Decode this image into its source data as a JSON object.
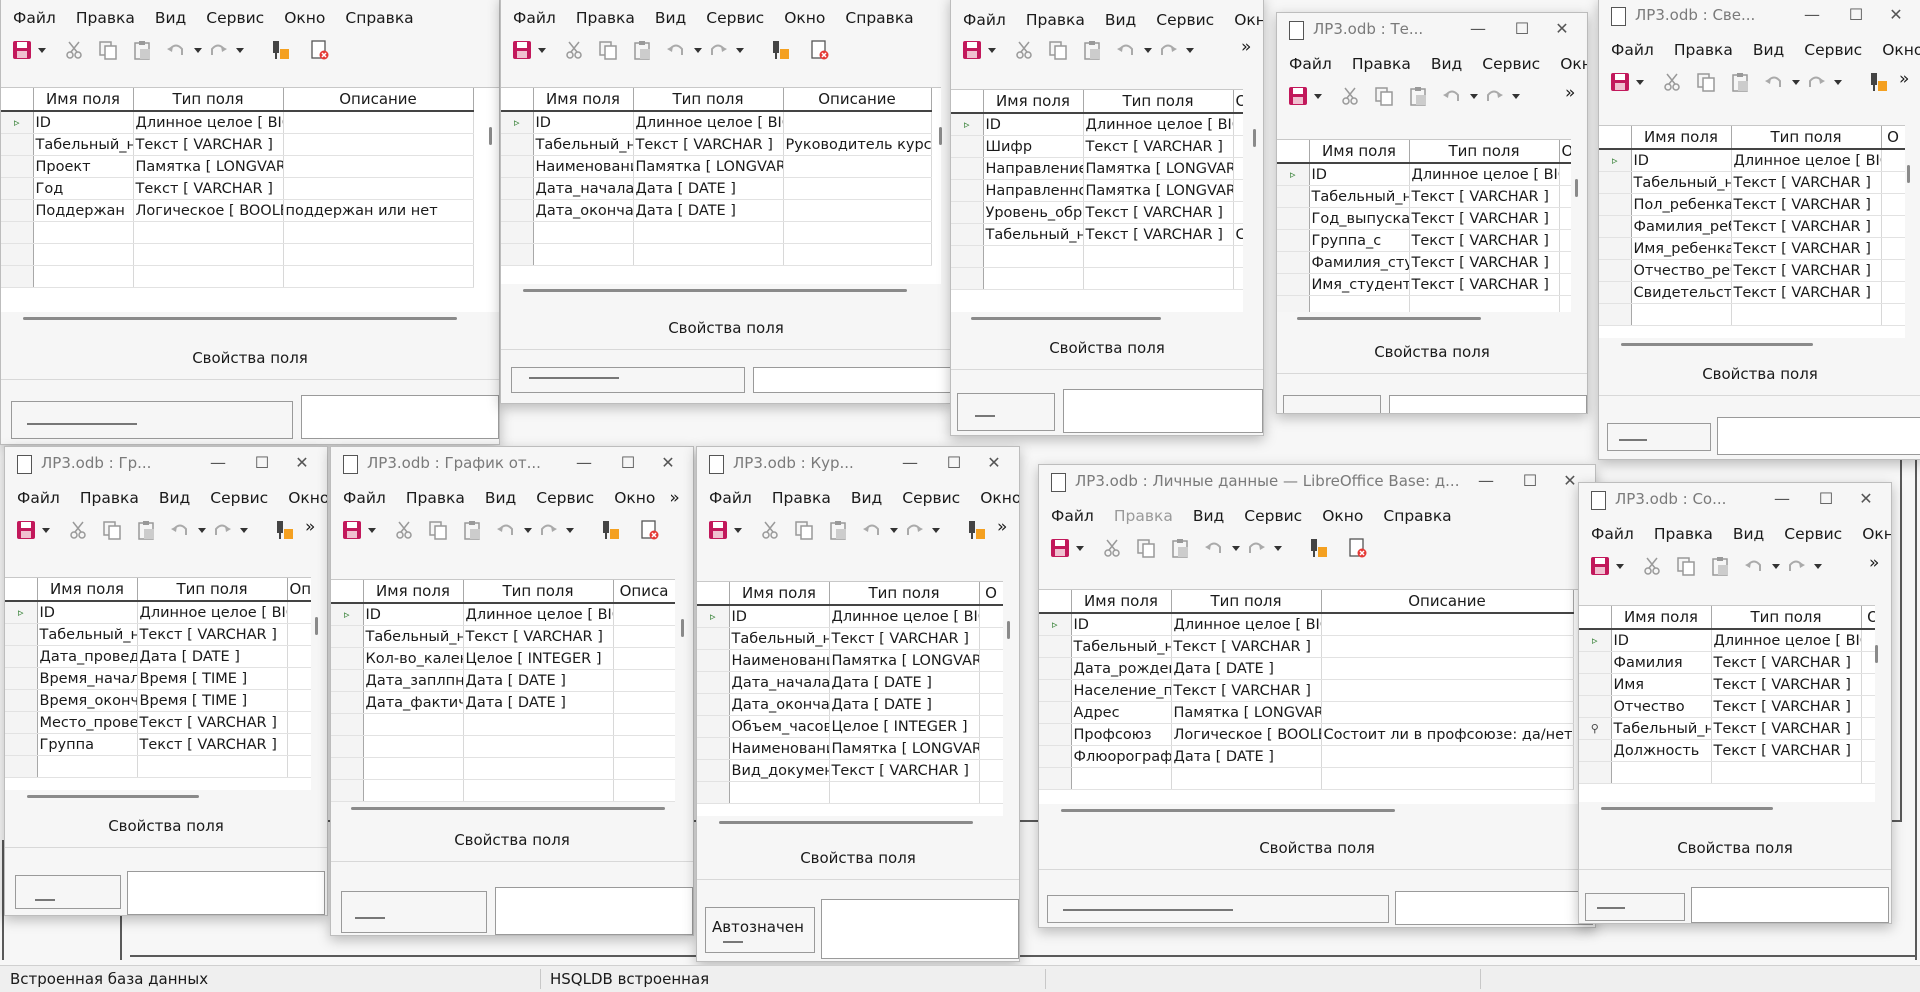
{
  "menus": {
    "file": "Файл",
    "edit": "Правка",
    "view": "Вид",
    "tools": "Сервис",
    "window": "Окно",
    "help": "Справка"
  },
  "headers": {
    "field_name": "Имя поля",
    "field_type": "Тип поля",
    "description": "Описание",
    "desc_short1": "Оп.",
    "desc_short2": "Опи",
    "desc_short3": "О",
    "desc_short4": "Описа",
    "desc_short5": "Оп"
  },
  "props_label": "Свойства поля",
  "autovalue_label": "Автозначен",
  "status": {
    "left": "Встроенная база данных",
    "middle": "HSQLDB встроенная"
  },
  "windows": {
    "w1": {
      "rows": [
        [
          "ID",
          "Длинное целое [ BIG",
          ""
        ],
        [
          "Табельный_н",
          "Текст [ VARCHAR ]",
          ""
        ],
        [
          "Проект",
          "Памятка [ LONGVARC",
          ""
        ],
        [
          "Год",
          "Текст [ VARCHAR ]",
          ""
        ],
        [
          "Поддержан",
          "Логическое [ BOOLEA",
          "поддержан или нет"
        ]
      ]
    },
    "w2": {
      "rows": [
        [
          "ID",
          "Длинное целое [ BIG",
          ""
        ],
        [
          "Табельный_нс",
          "Текст [ VARCHAR ]",
          "Руководитель курсо"
        ],
        [
          "Наименовани",
          "Памятка [ LONGVARC",
          ""
        ],
        [
          "Дата_начала_",
          "Дата [ DATE ]",
          ""
        ],
        [
          "Дата_окончан",
          "Дата [ DATE ]",
          ""
        ]
      ]
    },
    "w3": {
      "rows": [
        [
          "ID",
          "Длинное целое [ BIG",
          ""
        ],
        [
          "Шифр",
          "Текст [ VARCHAR ]",
          ""
        ],
        [
          "Направление",
          "Памятка [ LONGVARC",
          ""
        ],
        [
          "Направленно",
          "Памятка [ LONGVARC",
          ""
        ],
        [
          "Уровень_обра",
          "Текст [ VARCHAR ]",
          ""
        ],
        [
          "Табельный_нс",
          "Текст [ VARCHAR ]",
          "С"
        ]
      ]
    },
    "w4": {
      "title": "ЛР3.odb : Те...",
      "rows": [
        [
          "ID",
          "Длинное целое [ BIG",
          ""
        ],
        [
          "Табельный_нс",
          "Текст [ VARCHAR ]",
          ""
        ],
        [
          "Год_выпуска",
          "Текст [ VARCHAR ]",
          ""
        ],
        [
          "Группа_с",
          "Текст [ VARCHAR ]",
          ""
        ],
        [
          "Фамилия_студ",
          "Текст [ VARCHAR ]",
          ""
        ],
        [
          "Имя_студента",
          "Текст [ VARCHAR ]",
          ""
        ]
      ]
    },
    "w5": {
      "title": "ЛР3.odb : Све...",
      "rows": [
        [
          "ID",
          "Длинное целое [ BIG",
          ""
        ],
        [
          "Табельный_нс",
          "Текст [ VARCHAR ]",
          ""
        ],
        [
          "Пол_ребенка",
          "Текст [ VARCHAR ]",
          ""
        ],
        [
          "Фамилия_реб",
          "Текст [ VARCHAR ]",
          ""
        ],
        [
          "Имя_ребенка",
          "Текст [ VARCHAR ]",
          ""
        ],
        [
          "Отчество_реб",
          "Текст [ VARCHAR ]",
          ""
        ],
        [
          "Свидетельств",
          "Текст [ VARCHAR ]",
          ""
        ]
      ]
    },
    "w6": {
      "title": "ЛР3.odb : Гр...",
      "rows": [
        [
          "ID",
          "Длинное целое [ BIG",
          ""
        ],
        [
          "Табельный_нс",
          "Текст [ VARCHAR ]",
          ""
        ],
        [
          "Дата_проведе",
          "Дата [ DATE ]",
          ""
        ],
        [
          "Время_начала",
          "Время [ TIME ]",
          ""
        ],
        [
          "Время_оконча",
          "Время [ TIME ]",
          ""
        ],
        [
          "Место_прове,",
          "Текст [ VARCHAR ]",
          ""
        ],
        [
          "Группа",
          "Текст [ VARCHAR ]",
          ""
        ]
      ]
    },
    "w7": {
      "title": "ЛР3.odb : График от...",
      "rows": [
        [
          "ID",
          "Длинное целое [ BIG",
          ""
        ],
        [
          "Табельный_нс",
          "Текст [ VARCHAR ]",
          ""
        ],
        [
          "Кол-во_кален,",
          "Целое [ INTEGER ]",
          ""
        ],
        [
          "Дата_заплпни",
          "Дата [ DATE ]",
          ""
        ],
        [
          "Дата_фактиче",
          "Дата [ DATE ]",
          ""
        ]
      ]
    },
    "w8": {
      "title": "ЛР3.odb : Кур...",
      "rows": [
        [
          "ID",
          "Длинное целое [ BIG",
          ""
        ],
        [
          "Табельный_нс",
          "Текст [ VARCHAR ]",
          ""
        ],
        [
          "Наименовани",
          "Памятка [ LONGVARC",
          ""
        ],
        [
          "Дата_начала",
          "Дата [ DATE ]",
          ""
        ],
        [
          "Дата_окончан",
          "Дата [ DATE ]",
          ""
        ],
        [
          "Объем_часов",
          "Целое [ INTEGER ]",
          ""
        ],
        [
          "Наименовани",
          "Памятка [ LONGVARC",
          ""
        ],
        [
          "Вид_документ",
          "Текст [ VARCHAR ]",
          ""
        ]
      ]
    },
    "w9": {
      "title": "ЛР3.odb : Личные данные — LibreOffice Base: д...",
      "rows": [
        [
          "ID",
          "Длинное целое [ BIG",
          ""
        ],
        [
          "Табельный_нс",
          "Текст [ VARCHAR ]",
          ""
        ],
        [
          "Дата_рождени",
          "Дата [ DATE ]",
          ""
        ],
        [
          "Население_пу",
          "Текст [ VARCHAR ]",
          ""
        ],
        [
          "Адрес",
          "Памятка [ LONGVARC",
          ""
        ],
        [
          "Профсоюз",
          "Логическое [ BOOLEA",
          "Состоит ли в профсоюзе: да/нет"
        ],
        [
          "Флюорографи",
          "Дата [ DATE ]",
          ""
        ]
      ]
    },
    "w10": {
      "title": "ЛР3.odb : Со...",
      "rows": [
        [
          "ID",
          "Длинное целое [ BIG",
          ""
        ],
        [
          "Фамилия",
          "Текст [ VARCHAR ]",
          ""
        ],
        [
          "Имя",
          "Текст [ VARCHAR ]",
          ""
        ],
        [
          "Отчество",
          "Текст [ VARCHAR ]",
          ""
        ],
        [
          "Табельный_нс",
          "Текст [ VARCHAR ]",
          ""
        ],
        [
          "Должность",
          "Текст [ VARCHAR ]",
          ""
        ]
      ]
    }
  }
}
